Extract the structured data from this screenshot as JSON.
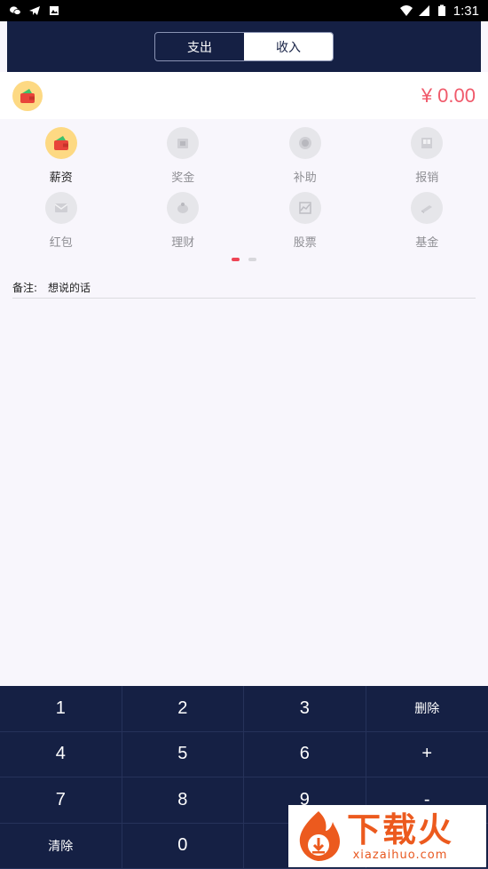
{
  "status_bar": {
    "time": "1:31"
  },
  "header": {
    "tabs": [
      {
        "label": "支出"
      },
      {
        "label": "收入"
      }
    ]
  },
  "amount": {
    "value": "¥ 0.00"
  },
  "categories": [
    {
      "label": "薪资"
    },
    {
      "label": "奖金"
    },
    {
      "label": "补助"
    },
    {
      "label": "报销"
    },
    {
      "label": "红包"
    },
    {
      "label": "理财"
    },
    {
      "label": "股票"
    },
    {
      "label": "基金"
    }
  ],
  "note": {
    "label": "备注:",
    "placeholder": "想说的话"
  },
  "keypad": {
    "keys": [
      "1",
      "2",
      "3",
      "删除",
      "4",
      "5",
      "6",
      "+",
      "7",
      "8",
      "9",
      "-",
      "清除",
      "0",
      "",
      ""
    ]
  },
  "watermark": {
    "cn": "下载火",
    "en": "xiazaihuo.com"
  },
  "colors": {
    "navy": "#152044",
    "accent_red": "#f05a6b",
    "icon_yellow": "#fdd983"
  }
}
